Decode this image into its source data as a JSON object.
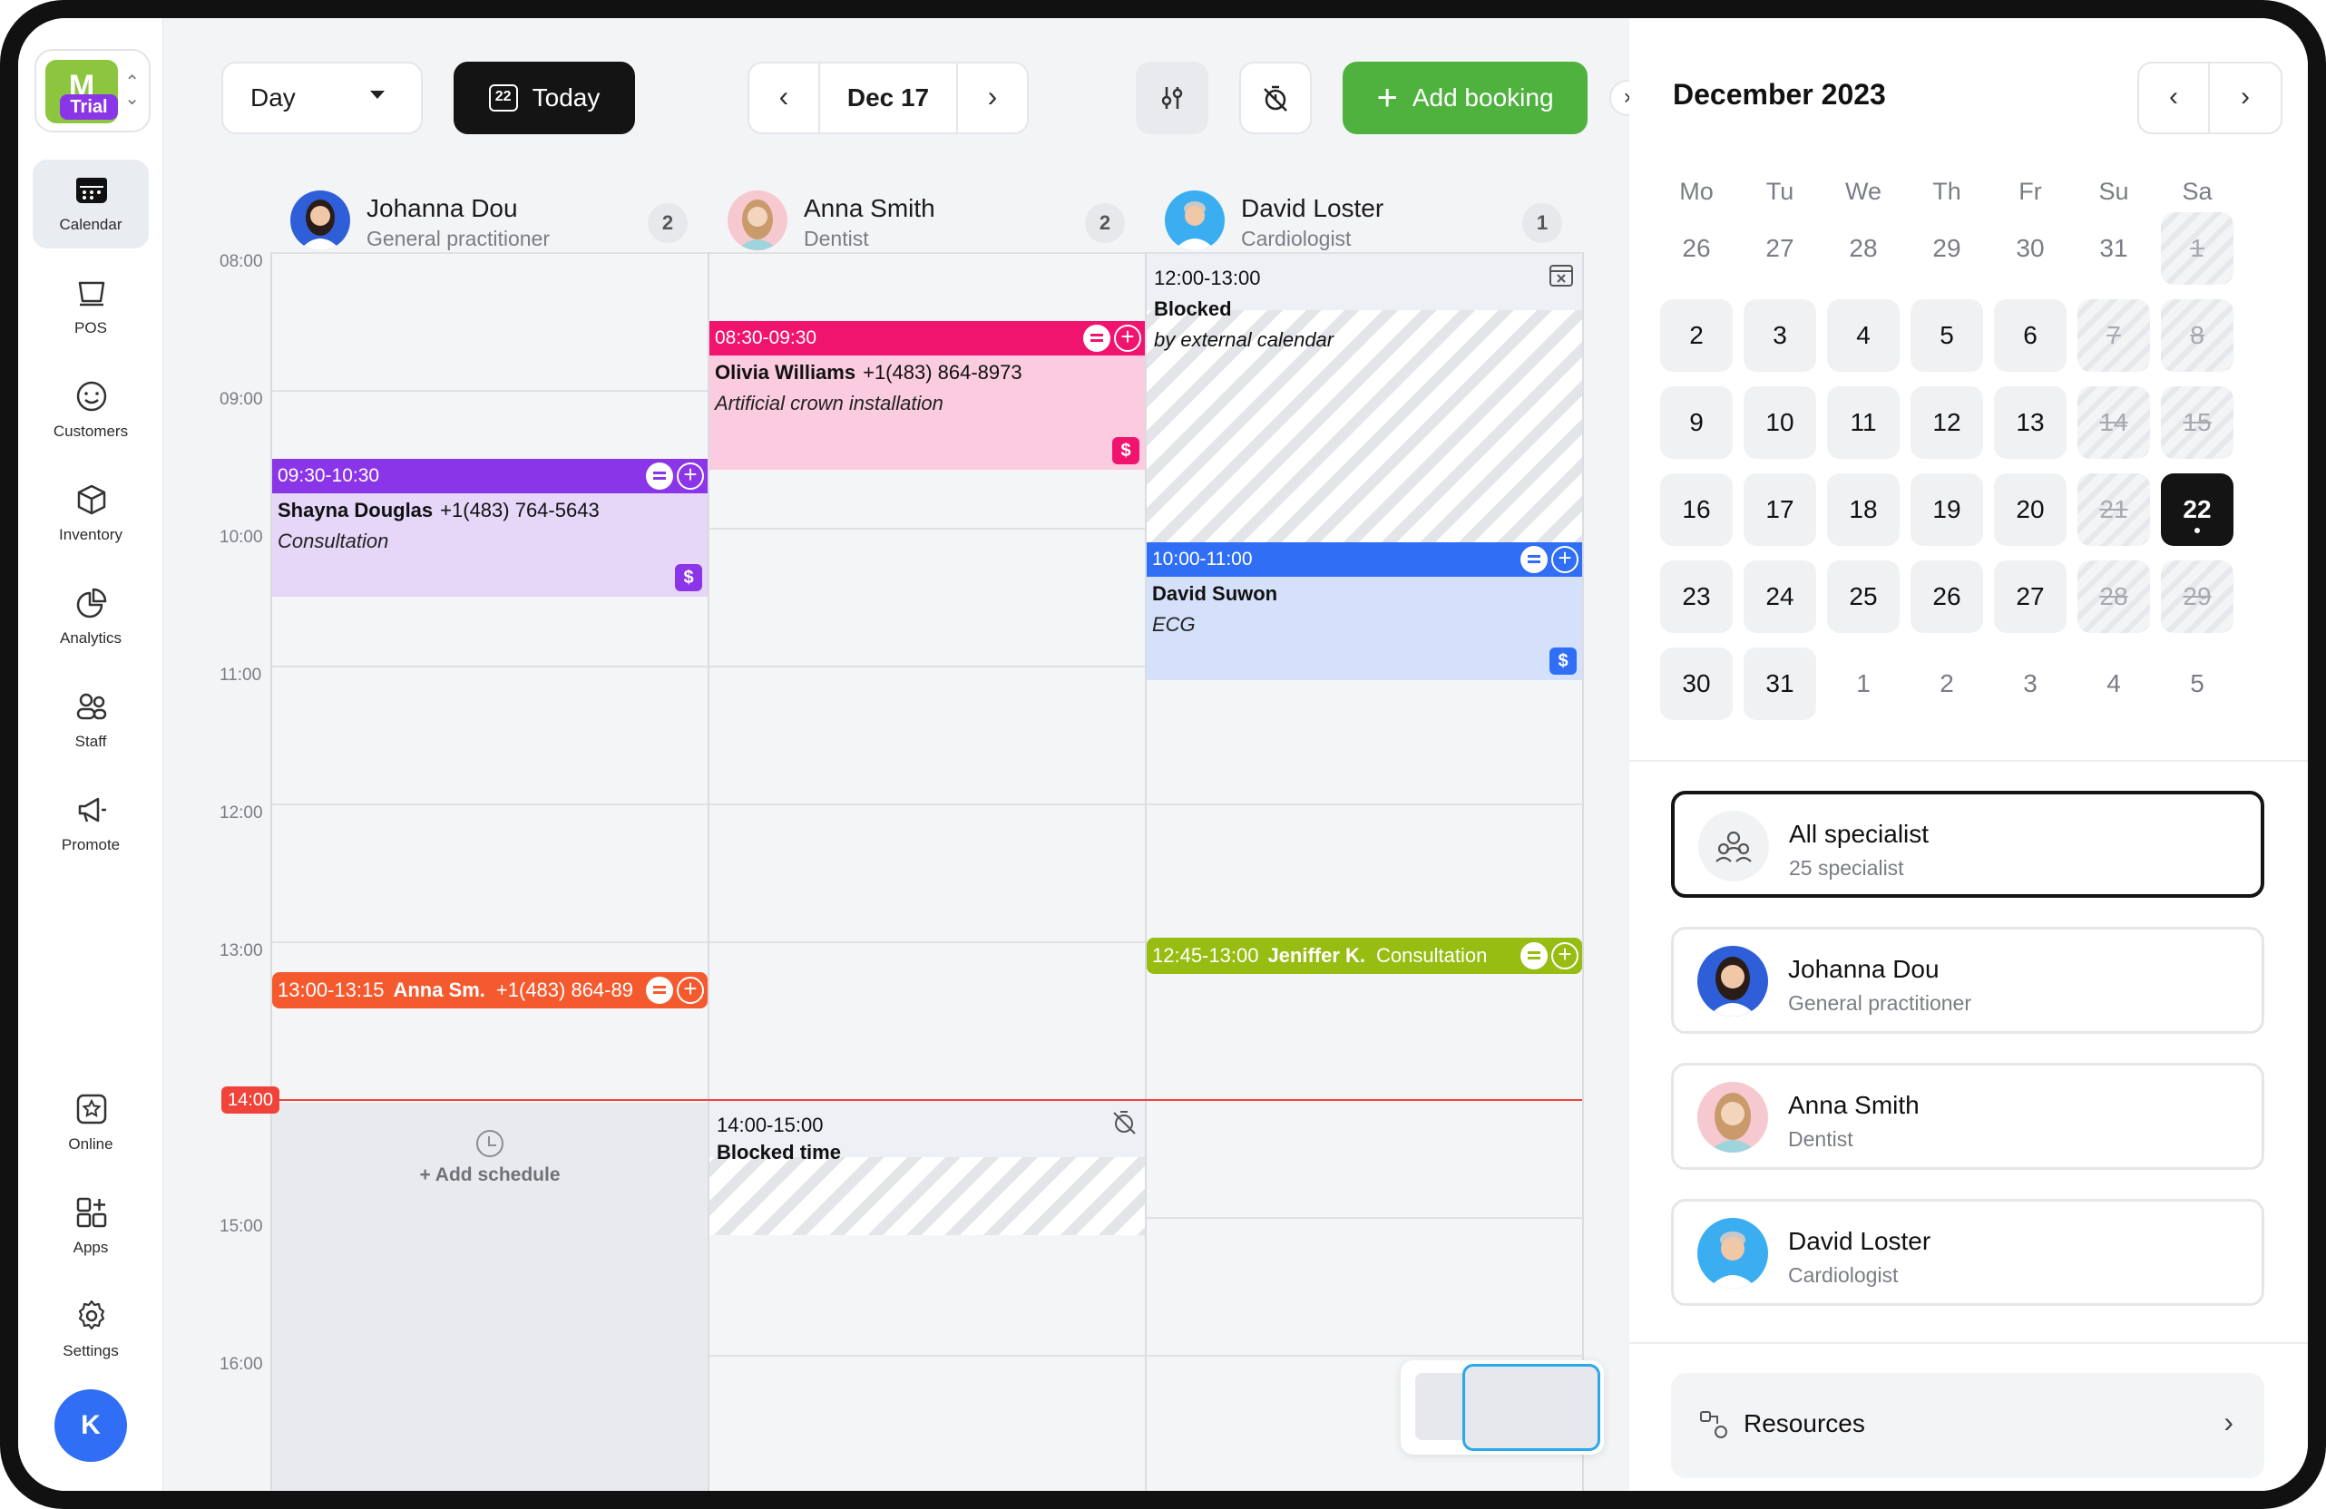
{
  "app": {
    "logo_letter": "M",
    "logo_badge": "Trial",
    "user_initial": "K",
    "accent": "#4fb23f"
  },
  "sidebar": {
    "top_items": [
      {
        "label": "Calendar",
        "icon": "calendar-icon"
      },
      {
        "label": "POS",
        "icon": "pos-icon"
      },
      {
        "label": "Customers",
        "icon": "customers-icon"
      },
      {
        "label": "Inventory",
        "icon": "inventory-icon"
      },
      {
        "label": "Analytics",
        "icon": "analytics-icon"
      },
      {
        "label": "Staff",
        "icon": "staff-icon"
      },
      {
        "label": "Promote",
        "icon": "promote-icon"
      }
    ],
    "bottom_items": [
      {
        "label": "Online",
        "icon": "online-icon"
      },
      {
        "label": "Apps",
        "icon": "apps-icon"
      },
      {
        "label": "Settings",
        "icon": "settings-icon"
      }
    ]
  },
  "toolbar": {
    "view_select": "Day",
    "today_label": "Today",
    "today_icon_day": "22",
    "current_date": "Dec 17",
    "add_booking_label": "Add booking"
  },
  "staff": [
    {
      "name": "Johanna Dou",
      "role": "General practitioner",
      "count": "2"
    },
    {
      "name": "Anna Smith",
      "role": "Dentist",
      "count": "2"
    },
    {
      "name": "David Loster",
      "role": "Cardiologist",
      "count": "1"
    }
  ],
  "times": [
    "08:00",
    "09:00",
    "10:00",
    "11:00",
    "12:00",
    "13:00",
    "15:00",
    "16:00"
  ],
  "now_time": "14:00",
  "add_schedule_label": "+ Add schedule",
  "bookings": {
    "olivia": {
      "time": "08:30-09:30",
      "name": "Olivia Williams",
      "phone": "+1(483) 864-8973",
      "service": "Artificial crown installation",
      "color": "#f0146f",
      "bg": "#fbcbe0"
    },
    "shayna": {
      "time": "09:30-10:30",
      "name": "Shayna Douglas",
      "phone": "+1(483) 764-5643",
      "service": "Consultation",
      "color": "#8b35e8",
      "bg": "#e6d6f8"
    },
    "suwon": {
      "time": "10:00-11:00",
      "name": "David Suwon",
      "service": "ECG",
      "color": "#2f6ef5",
      "bg": "#d5e1fa"
    },
    "anna": {
      "time": "13:00-13:15",
      "name": "Anna Sm.",
      "phone": "+1(483) 864-89",
      "color": "#f55a2f"
    },
    "jeniffer": {
      "time": "12:45-13:00",
      "name": "Jeniffer K.",
      "service": "Consultation",
      "color": "#97bd12"
    }
  },
  "blocked": {
    "external": {
      "time": "12:00-13:00",
      "title": "Blocked",
      "subtitle": "by external calendar"
    },
    "time": {
      "time": "14:00-15:00",
      "title": "Blocked time"
    }
  },
  "calendar": {
    "title": "December 2023",
    "weekdays": [
      "Mo",
      "Tu",
      "We",
      "Th",
      "Fr",
      "Su",
      "Sa"
    ],
    "weeks": [
      [
        {
          "d": "26",
          "s": "out"
        },
        {
          "d": "27",
          "s": "out"
        },
        {
          "d": "28",
          "s": "out"
        },
        {
          "d": "29",
          "s": "out"
        },
        {
          "d": "30",
          "s": "out"
        },
        {
          "d": "31",
          "s": "out"
        },
        {
          "d": "1",
          "s": "off"
        }
      ],
      [
        {
          "d": "2",
          "s": "cur"
        },
        {
          "d": "3",
          "s": "cur"
        },
        {
          "d": "4",
          "s": "cur"
        },
        {
          "d": "5",
          "s": "cur"
        },
        {
          "d": "6",
          "s": "cur"
        },
        {
          "d": "7",
          "s": "off"
        },
        {
          "d": "8",
          "s": "off"
        }
      ],
      [
        {
          "d": "9",
          "s": "cur"
        },
        {
          "d": "10",
          "s": "cur"
        },
        {
          "d": "11",
          "s": "cur"
        },
        {
          "d": "12",
          "s": "cur"
        },
        {
          "d": "13",
          "s": "cur"
        },
        {
          "d": "14",
          "s": "off"
        },
        {
          "d": "15",
          "s": "off"
        }
      ],
      [
        {
          "d": "16",
          "s": "cur"
        },
        {
          "d": "17",
          "s": "cur"
        },
        {
          "d": "18",
          "s": "cur"
        },
        {
          "d": "19",
          "s": "cur"
        },
        {
          "d": "20",
          "s": "cur"
        },
        {
          "d": "21",
          "s": "off"
        },
        {
          "d": "22",
          "s": "sel"
        }
      ],
      [
        {
          "d": "23",
          "s": "cur"
        },
        {
          "d": "24",
          "s": "cur"
        },
        {
          "d": "25",
          "s": "cur"
        },
        {
          "d": "26",
          "s": "cur"
        },
        {
          "d": "27",
          "s": "cur"
        },
        {
          "d": "28",
          "s": "off"
        },
        {
          "d": "29",
          "s": "off"
        }
      ],
      [
        {
          "d": "30",
          "s": "cur"
        },
        {
          "d": "31",
          "s": "cur"
        },
        {
          "d": "1",
          "s": "out"
        },
        {
          "d": "2",
          "s": "out"
        },
        {
          "d": "3",
          "s": "out"
        },
        {
          "d": "4",
          "s": "out"
        },
        {
          "d": "5",
          "s": "out"
        }
      ]
    ]
  },
  "specialists": [
    {
      "name": "All specialist",
      "sub": "25 specialist"
    },
    {
      "name": "Johanna Dou",
      "sub": "General practitioner"
    },
    {
      "name": "Anna Smith",
      "sub": "Dentist"
    },
    {
      "name": "David Loster",
      "sub": "Cardiologist"
    }
  ],
  "resources_label": "Resources"
}
